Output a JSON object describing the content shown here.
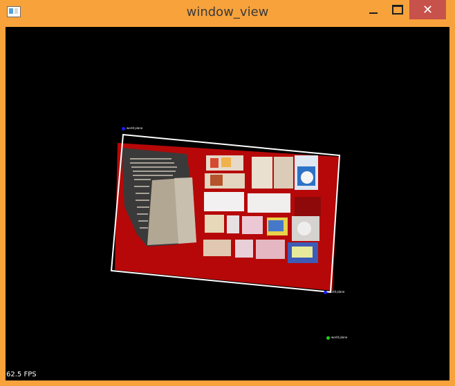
{
  "window": {
    "title": "window_view"
  },
  "controls": {
    "close_glyph": "✕"
  },
  "overlay": {
    "fps": "62.5 FPS",
    "markers": [
      {
        "label": "world plane",
        "color": "#1b1bff"
      },
      {
        "label": "world plane",
        "color": "#1b1bff"
      },
      {
        "label": "world plane",
        "color": "#1fd11f"
      }
    ]
  },
  "colors": {
    "frame": "#f7a23b",
    "viewport": "#000000",
    "pointcloud_red": "#c10a0a"
  }
}
